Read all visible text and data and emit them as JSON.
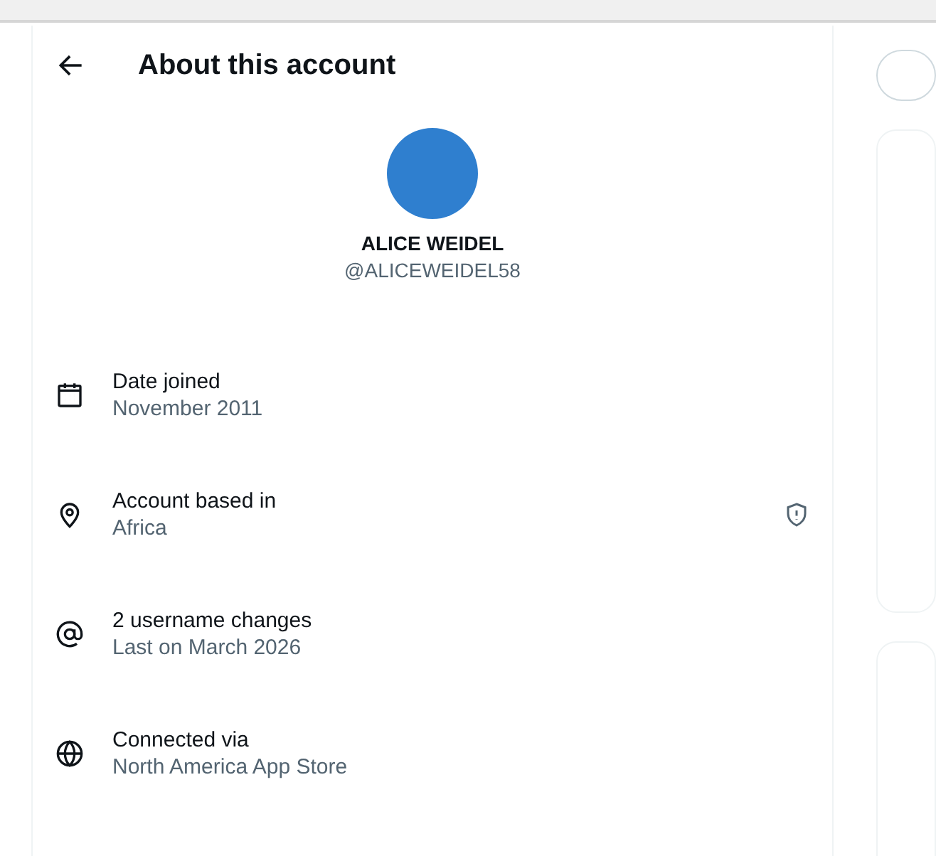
{
  "header": {
    "title": "About this account"
  },
  "profile": {
    "name": "ALICE WEIDEL",
    "handle": "@ALICEWEIDEL58"
  },
  "details": [
    {
      "kind": "calendar",
      "label": "Date joined",
      "value": "November 2011",
      "notice": false
    },
    {
      "kind": "location",
      "label": "Account based in",
      "value": "Africa",
      "notice": true
    },
    {
      "kind": "at",
      "label": "2 username changes",
      "value": "Last on March 2026",
      "notice": false
    },
    {
      "kind": "globe",
      "label": "Connected via",
      "value": "North America App Store",
      "notice": false
    }
  ]
}
